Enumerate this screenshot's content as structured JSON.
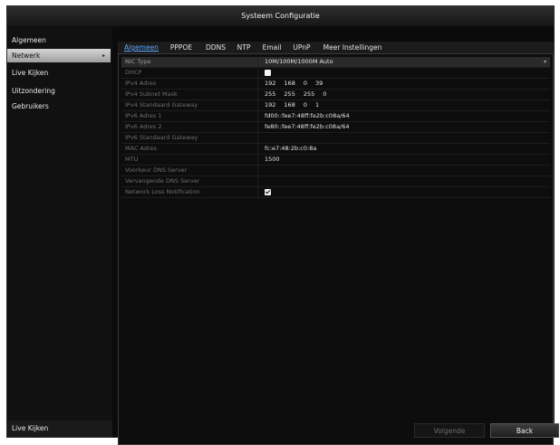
{
  "window": {
    "title": "Systeem Configuratie"
  },
  "sidebar": {
    "items": [
      {
        "label": "Algemeen",
        "selected": false
      },
      {
        "label": "Netwerk",
        "selected": true
      },
      {
        "label": "Live Kijken",
        "selected": false
      },
      {
        "label": "Uitzondering",
        "selected": false
      },
      {
        "label": "Gebruikers",
        "selected": false
      }
    ],
    "footer": "Live Kijken",
    "selected_arrow": "▸"
  },
  "tabs": [
    {
      "label": "Algemeen",
      "active": true
    },
    {
      "label": "PPPOE",
      "active": false
    },
    {
      "label": "DDNS",
      "active": false
    },
    {
      "label": "NTP",
      "active": false
    },
    {
      "label": "Email",
      "active": false
    },
    {
      "label": "UPnP",
      "active": false
    },
    {
      "label": "Meer Instellingen",
      "active": false
    }
  ],
  "settings": {
    "nic_type": {
      "label": "NIC Type",
      "value": "10M/100M/1000M Auto",
      "caret": "▾"
    },
    "dhcp": {
      "label": "DHCP",
      "checked": false
    },
    "ipv4_address": {
      "label": "IPv4 Adres",
      "parts": [
        "192",
        "168",
        "0",
        "39"
      ]
    },
    "ipv4_subnet_mask": {
      "label": "IPv4 Subnet Mask",
      "parts": [
        "255",
        "255",
        "255",
        "0"
      ]
    },
    "ipv4_default_gateway": {
      "label": "IPv4 Standaard Gateway",
      "parts": [
        "192",
        "168",
        "0",
        "1"
      ]
    },
    "ipv6_address_1": {
      "label": "IPv6 Adres 1",
      "value": "fd00::fee7:48ff:fe2b:c08a/64"
    },
    "ipv6_address_2": {
      "label": "IPv6 Adres 2",
      "value": "fe80::fee7:48ff:fe2b:c08a/64"
    },
    "ipv6_default_gateway": {
      "label": "IPv6 Standaard Gateway",
      "value": ""
    },
    "mac_address": {
      "label": "MAC Adres",
      "value": "fc:e7:48:2b:c0:8a"
    },
    "mtu": {
      "label": "MTU",
      "value": "1500"
    },
    "preferred_dns": {
      "label": "Voorkeur DNS Server",
      "value": ""
    },
    "alternate_dns": {
      "label": "Vervangende DNS Server",
      "value": ""
    },
    "network_loss_notification": {
      "label": "Network Loss Notification",
      "checked": true
    }
  },
  "buttons": {
    "next": "Volgende",
    "back": "Back"
  }
}
